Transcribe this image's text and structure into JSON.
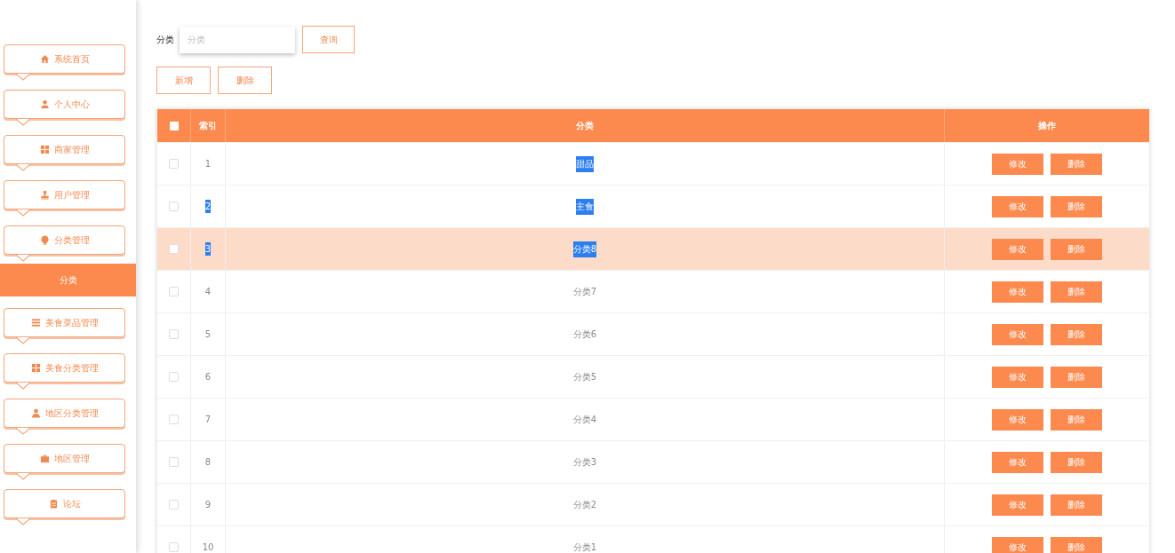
{
  "sidebar": {
    "menu": [
      {
        "label": "系统首页"
      },
      {
        "label": "个人中心"
      },
      {
        "label": "商家管理"
      },
      {
        "label": "用户管理"
      },
      {
        "label": "分类管理",
        "children": [
          {
            "label": "分类",
            "selected": true
          }
        ]
      },
      {
        "label": "美食菜品管理"
      },
      {
        "label": "美食分类管理"
      },
      {
        "label": "地区分类管理"
      },
      {
        "label": "地区管理"
      },
      {
        "label": "论坛"
      }
    ]
  },
  "search": {
    "label": "分类",
    "placeholder": "分类",
    "button": "查询"
  },
  "actions": [
    "新增",
    "删除"
  ],
  "table": {
    "columns": [
      "索引",
      "分类",
      "操作"
    ],
    "select_all_checked": false,
    "rows": [
      {
        "index": "1",
        "name": "甜品",
        "hovered": false,
        "index_selected": false,
        "name_selected": true,
        "checked": false,
        "actions": [
          "修改",
          "删除"
        ]
      },
      {
        "index": "2",
        "name": "主食",
        "hovered": false,
        "index_selected": true,
        "name_selected": true,
        "checked": false,
        "actions": [
          "修改",
          "删除"
        ]
      },
      {
        "index": "3",
        "name": "分类8",
        "hovered": true,
        "index_selected": true,
        "name_selected": true,
        "checked": false,
        "actions": [
          "修改",
          "删除"
        ]
      },
      {
        "index": "4",
        "name": "分类7",
        "hovered": false,
        "index_selected": false,
        "name_selected": false,
        "checked": false,
        "actions": [
          "修改",
          "删除"
        ]
      },
      {
        "index": "5",
        "name": "分类6",
        "hovered": false,
        "index_selected": false,
        "name_selected": false,
        "checked": false,
        "actions": [
          "修改",
          "删除"
        ]
      },
      {
        "index": "6",
        "name": "分类5",
        "hovered": false,
        "index_selected": false,
        "name_selected": false,
        "checked": false,
        "actions": [
          "修改",
          "删除"
        ]
      },
      {
        "index": "7",
        "name": "分类4",
        "hovered": false,
        "index_selected": false,
        "name_selected": false,
        "checked": false,
        "actions": [
          "修改",
          "删除"
        ]
      },
      {
        "index": "8",
        "name": "分类3",
        "hovered": false,
        "index_selected": false,
        "name_selected": false,
        "checked": false,
        "actions": [
          "修改",
          "删除"
        ]
      },
      {
        "index": "9",
        "name": "分类2",
        "hovered": false,
        "index_selected": false,
        "name_selected": false,
        "checked": false,
        "actions": [
          "修改",
          "删除"
        ]
      },
      {
        "index": "10",
        "name": "分类1",
        "hovered": false,
        "index_selected": false,
        "name_selected": false,
        "checked": false,
        "actions": [
          "修改",
          "删除"
        ]
      }
    ]
  }
}
